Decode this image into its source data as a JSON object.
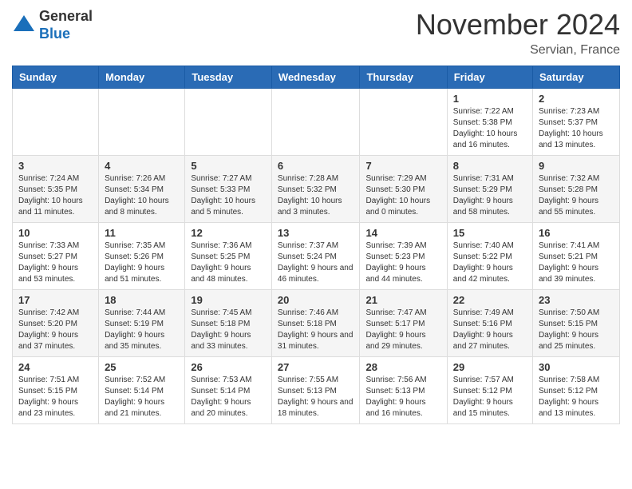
{
  "header": {
    "logo_general": "General",
    "logo_blue": "Blue",
    "month_title": "November 2024",
    "location": "Servian, France"
  },
  "weekdays": [
    "Sunday",
    "Monday",
    "Tuesday",
    "Wednesday",
    "Thursday",
    "Friday",
    "Saturday"
  ],
  "weeks": [
    [
      {
        "day": "",
        "info": ""
      },
      {
        "day": "",
        "info": ""
      },
      {
        "day": "",
        "info": ""
      },
      {
        "day": "",
        "info": ""
      },
      {
        "day": "",
        "info": ""
      },
      {
        "day": "1",
        "info": "Sunrise: 7:22 AM\nSunset: 5:38 PM\nDaylight: 10 hours and 16 minutes."
      },
      {
        "day": "2",
        "info": "Sunrise: 7:23 AM\nSunset: 5:37 PM\nDaylight: 10 hours and 13 minutes."
      }
    ],
    [
      {
        "day": "3",
        "info": "Sunrise: 7:24 AM\nSunset: 5:35 PM\nDaylight: 10 hours and 11 minutes."
      },
      {
        "day": "4",
        "info": "Sunrise: 7:26 AM\nSunset: 5:34 PM\nDaylight: 10 hours and 8 minutes."
      },
      {
        "day": "5",
        "info": "Sunrise: 7:27 AM\nSunset: 5:33 PM\nDaylight: 10 hours and 5 minutes."
      },
      {
        "day": "6",
        "info": "Sunrise: 7:28 AM\nSunset: 5:32 PM\nDaylight: 10 hours and 3 minutes."
      },
      {
        "day": "7",
        "info": "Sunrise: 7:29 AM\nSunset: 5:30 PM\nDaylight: 10 hours and 0 minutes."
      },
      {
        "day": "8",
        "info": "Sunrise: 7:31 AM\nSunset: 5:29 PM\nDaylight: 9 hours and 58 minutes."
      },
      {
        "day": "9",
        "info": "Sunrise: 7:32 AM\nSunset: 5:28 PM\nDaylight: 9 hours and 55 minutes."
      }
    ],
    [
      {
        "day": "10",
        "info": "Sunrise: 7:33 AM\nSunset: 5:27 PM\nDaylight: 9 hours and 53 minutes."
      },
      {
        "day": "11",
        "info": "Sunrise: 7:35 AM\nSunset: 5:26 PM\nDaylight: 9 hours and 51 minutes."
      },
      {
        "day": "12",
        "info": "Sunrise: 7:36 AM\nSunset: 5:25 PM\nDaylight: 9 hours and 48 minutes."
      },
      {
        "day": "13",
        "info": "Sunrise: 7:37 AM\nSunset: 5:24 PM\nDaylight: 9 hours and 46 minutes."
      },
      {
        "day": "14",
        "info": "Sunrise: 7:39 AM\nSunset: 5:23 PM\nDaylight: 9 hours and 44 minutes."
      },
      {
        "day": "15",
        "info": "Sunrise: 7:40 AM\nSunset: 5:22 PM\nDaylight: 9 hours and 42 minutes."
      },
      {
        "day": "16",
        "info": "Sunrise: 7:41 AM\nSunset: 5:21 PM\nDaylight: 9 hours and 39 minutes."
      }
    ],
    [
      {
        "day": "17",
        "info": "Sunrise: 7:42 AM\nSunset: 5:20 PM\nDaylight: 9 hours and 37 minutes."
      },
      {
        "day": "18",
        "info": "Sunrise: 7:44 AM\nSunset: 5:19 PM\nDaylight: 9 hours and 35 minutes."
      },
      {
        "day": "19",
        "info": "Sunrise: 7:45 AM\nSunset: 5:18 PM\nDaylight: 9 hours and 33 minutes."
      },
      {
        "day": "20",
        "info": "Sunrise: 7:46 AM\nSunset: 5:18 PM\nDaylight: 9 hours and 31 minutes."
      },
      {
        "day": "21",
        "info": "Sunrise: 7:47 AM\nSunset: 5:17 PM\nDaylight: 9 hours and 29 minutes."
      },
      {
        "day": "22",
        "info": "Sunrise: 7:49 AM\nSunset: 5:16 PM\nDaylight: 9 hours and 27 minutes."
      },
      {
        "day": "23",
        "info": "Sunrise: 7:50 AM\nSunset: 5:15 PM\nDaylight: 9 hours and 25 minutes."
      }
    ],
    [
      {
        "day": "24",
        "info": "Sunrise: 7:51 AM\nSunset: 5:15 PM\nDaylight: 9 hours and 23 minutes."
      },
      {
        "day": "25",
        "info": "Sunrise: 7:52 AM\nSunset: 5:14 PM\nDaylight: 9 hours and 21 minutes."
      },
      {
        "day": "26",
        "info": "Sunrise: 7:53 AM\nSunset: 5:14 PM\nDaylight: 9 hours and 20 minutes."
      },
      {
        "day": "27",
        "info": "Sunrise: 7:55 AM\nSunset: 5:13 PM\nDaylight: 9 hours and 18 minutes."
      },
      {
        "day": "28",
        "info": "Sunrise: 7:56 AM\nSunset: 5:13 PM\nDaylight: 9 hours and 16 minutes."
      },
      {
        "day": "29",
        "info": "Sunrise: 7:57 AM\nSunset: 5:12 PM\nDaylight: 9 hours and 15 minutes."
      },
      {
        "day": "30",
        "info": "Sunrise: 7:58 AM\nSunset: 5:12 PM\nDaylight: 9 hours and 13 minutes."
      }
    ]
  ]
}
